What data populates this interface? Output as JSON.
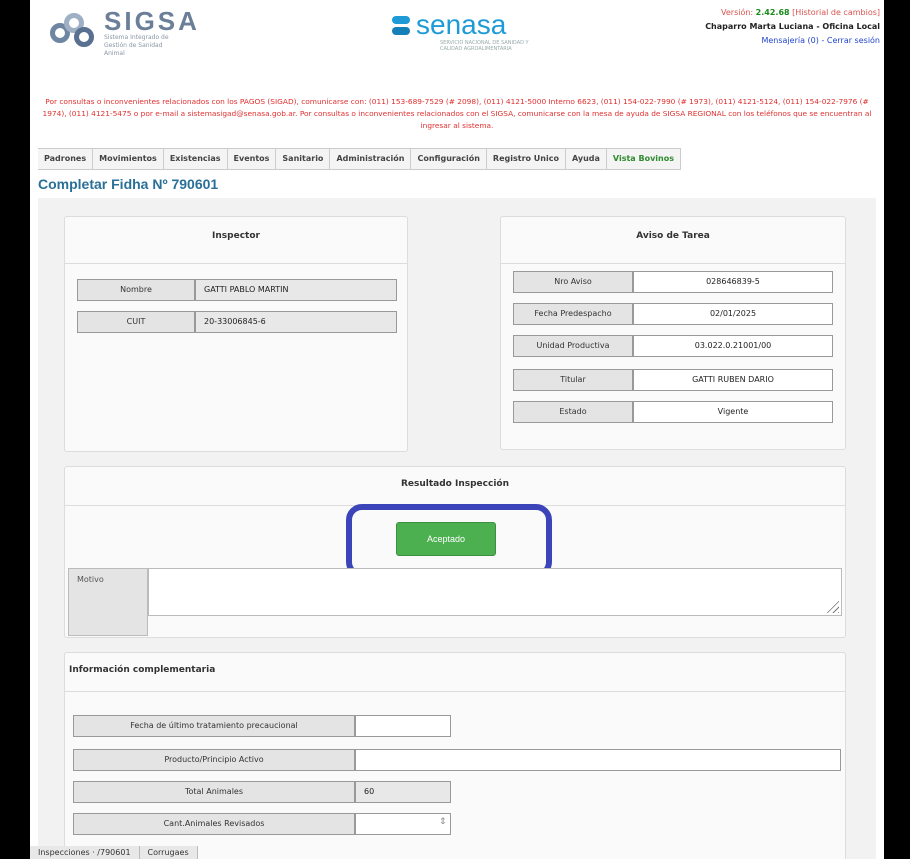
{
  "header": {
    "logo_title": "SIGSA",
    "logo_subtitle": "Sistema Integrado de Gestión de Sanidad Animal",
    "senasa_word": "senasa",
    "senasa_subtitle": "SERVICIO NACIONAL DE SANIDAD Y CALIDAD AGROALIMENTARIA",
    "version_prefix": "Versión:",
    "version_number": "2.42.68",
    "version_history": "[Historial de cambios]",
    "user": "Chaparro Marta Luciana - Oficina Local",
    "messages_link": "Mensajería (0)",
    "separator": "-",
    "logout_link": "Cerrar sesión"
  },
  "notice": "Por consultas o inconvenientes relacionados con los PAGOS (SIGAD), comunicarse con: (011) 153-689-7529 (# 2098), (011) 4121-5000 Interno 6623, (011) 154-022-7990 (# 1973), (011) 4121-5124, (011) 154-022-7976 (# 1974), (011) 4121-5475 o por e-mail a sistemasigad@senasa.gob.ar. Por consultas o inconvenientes relacionados con el SIGSA, comunicarse con la mesa de ayuda de SIGSA REGIONAL con los teléfonos que se encuentran al ingresar al sistema.",
  "nav": {
    "items": [
      {
        "label": "Padrones"
      },
      {
        "label": "Movimientos"
      },
      {
        "label": "Existencias"
      },
      {
        "label": "Eventos"
      },
      {
        "label": "Sanitario"
      },
      {
        "label": "Administración"
      },
      {
        "label": "Configuración"
      },
      {
        "label": "Registro Unico"
      },
      {
        "label": "Ayuda"
      },
      {
        "label": "Vista Bovinos"
      }
    ]
  },
  "page_title": "Completar Fidha Nº 790601",
  "inspector": {
    "title": "Inspector",
    "nombre_label": "Nombre",
    "nombre_value": "GATTI PABLO MARTIN",
    "cuit_label": "CUIT",
    "cuit_value": "20-33006845-6"
  },
  "aviso": {
    "title": "Aviso de Tarea",
    "nro_label": "Nro Aviso",
    "nro_value": "028646839-5",
    "fecha_label": "Fecha Predespacho",
    "fecha_value": "02/01/2025",
    "unidad_label": "Unidad Productiva",
    "unidad_value": "03.022.0.21001/00",
    "titular_label": "Titular",
    "titular_value": "GATTI RUBEN DARIO",
    "estado_label": "Estado",
    "estado_value": "Vigente"
  },
  "resultado": {
    "title": "Resultado Inspección",
    "accept_label": "Aceptado",
    "motivo_label": "Motivo",
    "motivo_value": ""
  },
  "info": {
    "title": "Información complementaria",
    "fecha_tratamiento_label": "Fecha de último tratamiento precaucional",
    "fecha_tratamiento_value": "",
    "producto_label": "Producto/Principio Activo",
    "producto_value": "",
    "total_label": "Total Animales",
    "total_value": "60",
    "revisados_label": "Cant.Animales Revisados",
    "revisados_value": ""
  },
  "bottom_tabs": [
    {
      "label": "Inspecciones · /790601"
    },
    {
      "label": "Corrugaes"
    }
  ]
}
